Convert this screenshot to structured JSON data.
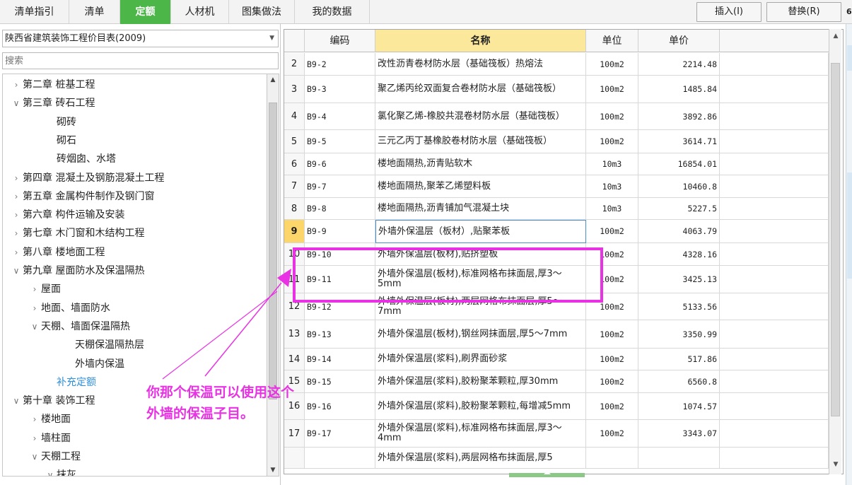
{
  "tabs": [
    "清单指引",
    "清单",
    "定额",
    "人材机",
    "图集做法",
    "我的数据"
  ],
  "active_tab": "定额",
  "toolbar": {
    "insert": "插入(I)",
    "replace": "替换(R)"
  },
  "edge_digit": "6",
  "catalog": {
    "selected": "陕西省建筑装饰工程价目表(2009)"
  },
  "search": {
    "placeholder": "搜索"
  },
  "tree": [
    {
      "label": "第二章 桩基工程",
      "caret": ">"
    },
    {
      "label": "第三章 砖石工程",
      "caret": "v"
    },
    {
      "label": "砌砖",
      "caret": ""
    },
    {
      "label": "砌石",
      "caret": ""
    },
    {
      "label": "砖烟囱、水塔",
      "caret": ""
    },
    {
      "label": "第四章 混凝土及钢筋混凝土工程",
      "caret": ">"
    },
    {
      "label": "第五章 金属构件制作及钢门窗",
      "caret": ">"
    },
    {
      "label": "第六章 构件运输及安装",
      "caret": ">"
    },
    {
      "label": "第七章 木门窗和木结构工程",
      "caret": ">"
    },
    {
      "label": "第八章 楼地面工程",
      "caret": ">"
    },
    {
      "label": "第九章 屋面防水及保温隔热",
      "caret": "v"
    },
    {
      "label": "屋面",
      "caret": ">"
    },
    {
      "label": "地面、墙面防水",
      "caret": ">"
    },
    {
      "label": "天棚、墙面保温隔热",
      "caret": "v"
    },
    {
      "label": "天棚保温隔热层",
      "caret": ""
    },
    {
      "label": "外墙内保温",
      "caret": ""
    },
    {
      "label": "补充定额",
      "caret": ""
    },
    {
      "label": "第十章 装饰工程",
      "caret": "v"
    },
    {
      "label": "楼地面",
      "caret": ">"
    },
    {
      "label": "墙柱面",
      "caret": ">"
    },
    {
      "label": "天棚工程",
      "caret": "v"
    },
    {
      "label": "抹灰",
      "caret": "v"
    }
  ],
  "grid": {
    "headers": {
      "code": "编码",
      "name": "名称",
      "unit": "单位",
      "price": "单价"
    },
    "rows": [
      {
        "no": "2",
        "code": "B9-2",
        "name": "改性沥青卷材防水层（基础筏板）热熔法",
        "unit": "100m2",
        "price": "2214.48"
      },
      {
        "no": "3",
        "code": "B9-3",
        "name": "聚乙烯丙纶双面复合卷材防水层（基础筏板）",
        "unit": "100m2",
        "price": "1485.84"
      },
      {
        "no": "4",
        "code": "B9-4",
        "name": "氯化聚乙烯-橡胶共混卷材防水层（基础筏板）",
        "unit": "100m2",
        "price": "3892.86"
      },
      {
        "no": "5",
        "code": "B9-5",
        "name": "三元乙丙丁基橡胶卷材防水层（基础筏板）",
        "unit": "100m2",
        "price": "3614.71"
      },
      {
        "no": "6",
        "code": "B9-6",
        "name": "楼地面隔热,沥青贴软木",
        "unit": "10m3",
        "price": "16854.01"
      },
      {
        "no": "7",
        "code": "B9-7",
        "name": "楼地面隔热,聚苯乙烯塑料板",
        "unit": "10m3",
        "price": "10460.8"
      },
      {
        "no": "8",
        "code": "B9-8",
        "name": "楼地面隔热,沥青铺加气混凝土块",
        "unit": "10m3",
        "price": "5227.5"
      },
      {
        "no": "9",
        "code": "B9-9",
        "name": "外墙外保温层（板材）,贴聚苯板",
        "unit": "100m2",
        "price": "4063.79"
      },
      {
        "no": "10",
        "code": "B9-10",
        "name": "外墙外保温层(板材),贴挤塑板",
        "unit": "100m2",
        "price": "4328.16"
      },
      {
        "no": "11",
        "code": "B9-11",
        "name": "外墙外保温层(板材),标准网格布抹面层,厚3～5mm",
        "unit": "100m2",
        "price": "3425.13"
      },
      {
        "no": "12",
        "code": "B9-12",
        "name": "外墙外保温层(板材),两层网格布抹面层,厚5～7mm",
        "unit": "100m2",
        "price": "5133.56"
      },
      {
        "no": "13",
        "code": "B9-13",
        "name": "外墙外保温层(板材),钢丝网抹面层,厚5～7mm",
        "unit": "100m2",
        "price": "3350.99"
      },
      {
        "no": "14",
        "code": "B9-14",
        "name": "外墙外保温层(浆料),刷界面砂浆",
        "unit": "100m2",
        "price": "517.86"
      },
      {
        "no": "15",
        "code": "B9-15",
        "name": "外墙外保温层(浆料),胶粉聚苯颗粒,厚30mm",
        "unit": "100m2",
        "price": "6560.8"
      },
      {
        "no": "16",
        "code": "B9-16",
        "name": "外墙外保温层(浆料),胶粉聚苯颗粒,每增减5mm",
        "unit": "100m2",
        "price": "1074.57"
      },
      {
        "no": "17",
        "code": "B9-17",
        "name": "外墙外保温层(浆料),标准网格布抹面层,厚3～4mm",
        "unit": "100m2",
        "price": "3343.07"
      },
      {
        "no": "",
        "code": "",
        "name": "外墙外保温层(浆料),两层网格布抹面层,厚5",
        "unit": "",
        "price": ""
      }
    ]
  },
  "annotation": {
    "line1": "你那个保温可以使用这个",
    "line2": "外墙的保温子目。"
  },
  "colors": {
    "active_tab": "#4db648",
    "name_header": "#fce89a",
    "annotation": "#e832e3",
    "link": "#2f8fd8"
  }
}
